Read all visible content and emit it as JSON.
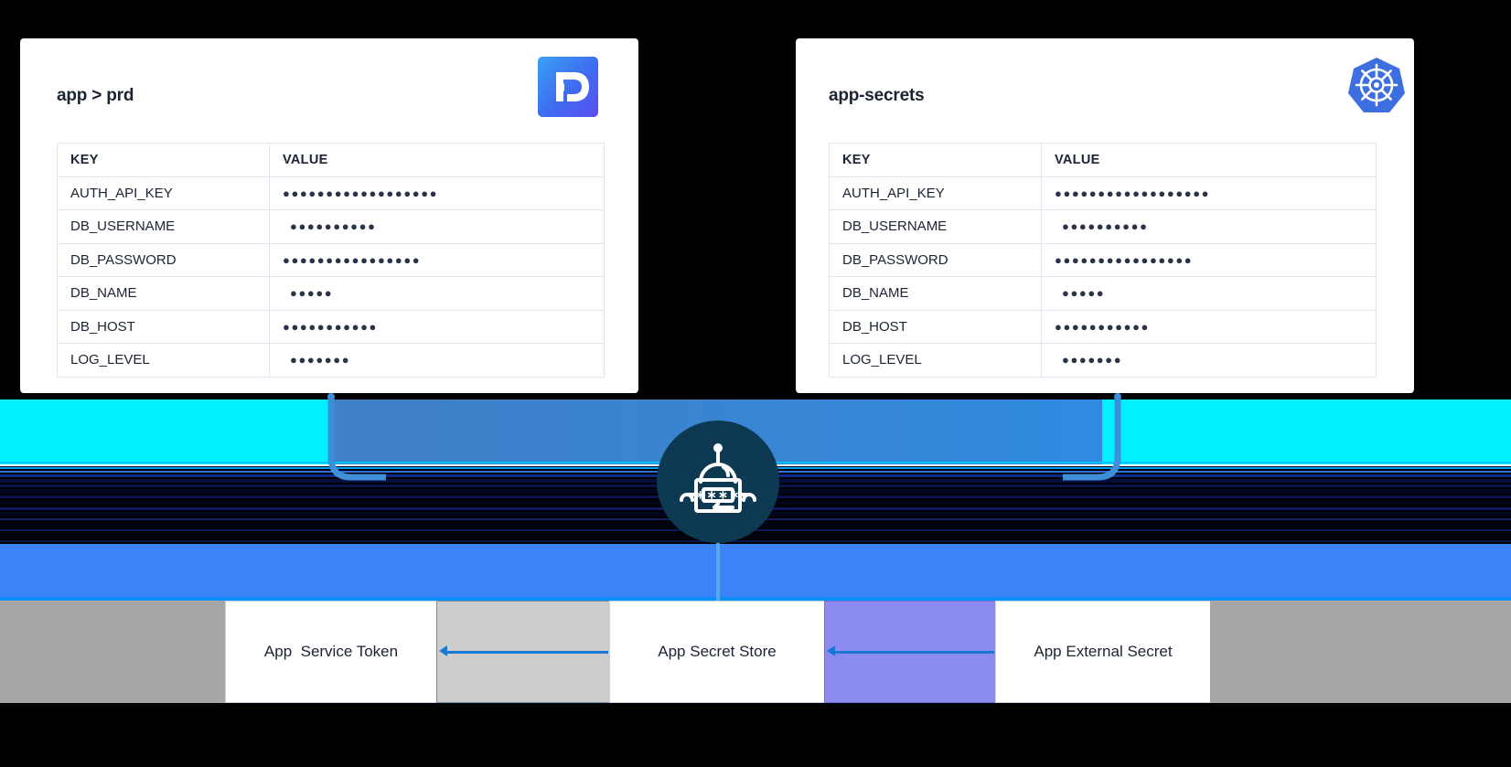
{
  "left_card": {
    "title": "app > prd",
    "logo_icon": "doppler-logo-icon",
    "table": {
      "headers": [
        "KEY",
        "VALUE"
      ],
      "rows": [
        {
          "key": "AUTH_API_KEY",
          "value": "●●●●●●●●●●●●●●●●●●"
        },
        {
          "key": "DB_USERNAME",
          "value": "●●●●●●●●●●"
        },
        {
          "key": "DB_PASSWORD",
          "value": "●●●●●●●●●●●●●●●●"
        },
        {
          "key": "DB_NAME",
          "value": "●●●●●"
        },
        {
          "key": "DB_HOST",
          "value": "●●●●●●●●●●●"
        },
        {
          "key": "LOG_LEVEL",
          "value": "●●●●●●●"
        }
      ]
    }
  },
  "right_card": {
    "title": "app-secrets",
    "logo_icon": "kubernetes-logo-icon",
    "table": {
      "headers": [
        "KEY",
        "VALUE"
      ],
      "rows": [
        {
          "key": "AUTH_API_KEY",
          "value": "●●●●●●●●●●●●●●●●●●"
        },
        {
          "key": "DB_USERNAME",
          "value": "●●●●●●●●●●"
        },
        {
          "key": "DB_PASSWORD",
          "value": "●●●●●●●●●●●●●●●●"
        },
        {
          "key": "DB_NAME",
          "value": "●●●●●"
        },
        {
          "key": "DB_HOST",
          "value": "●●●●●●●●●●●"
        },
        {
          "key": "LOG_LEVEL",
          "value": "●●●●●●●"
        }
      ]
    }
  },
  "center": {
    "icon": "robot-password-icon",
    "display_text": "∗∗∗∗",
    "badge_color": "#0d3a52"
  },
  "bottom_boxes": [
    {
      "label": "App  Service Token"
    },
    {
      "label": "App Secret Store"
    },
    {
      "label": "App External Secret"
    }
  ],
  "colors": {
    "cyan_band": "#00f0ff",
    "blue_band": "#3d82f7",
    "mid_band_start": "#3f80c8",
    "mid_band_end": "#2f8ae0",
    "grey_block": "#a6a6a6",
    "light_grey_block": "#cccccc",
    "purple_block": "#8c8cf0",
    "arrow": "#1b78d0",
    "card_border": "#dfe5ef",
    "text": "#1b2334"
  }
}
